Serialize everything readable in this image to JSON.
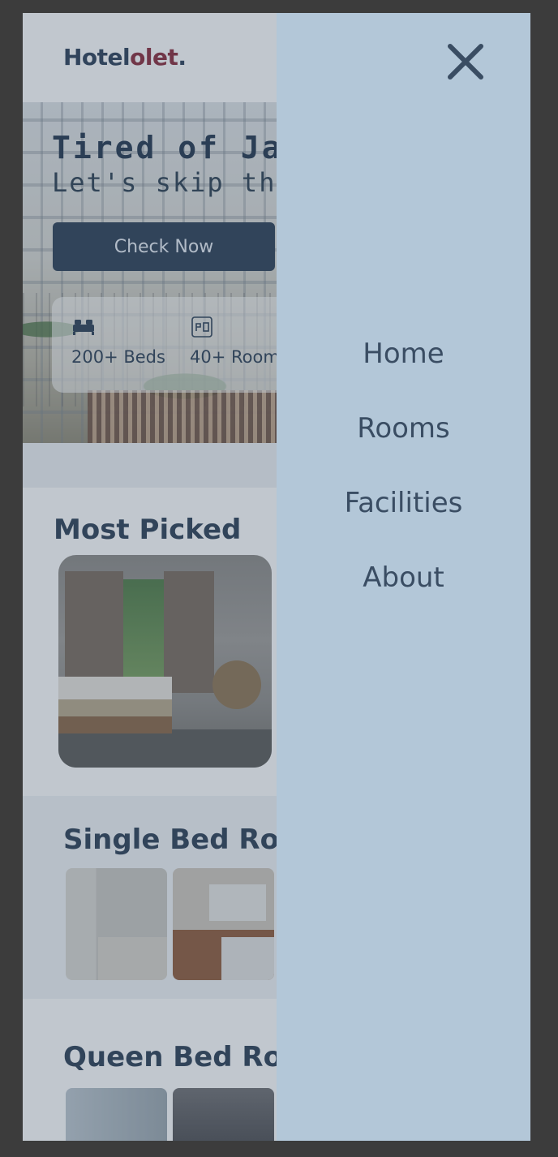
{
  "header": {
    "logo_main": "Hotel",
    "logo_accent": "olet",
    "logo_dot": "."
  },
  "hero": {
    "title": "Tired of Jak",
    "subtitle": "Let's skip the tr",
    "cta_label": "Check Now",
    "stats": [
      {
        "icon": "bed-icon",
        "label": "200+ Beds"
      },
      {
        "icon": "room-icon",
        "label": "40+ Room"
      }
    ]
  },
  "sections": {
    "most_picked": {
      "title": "Most Picked"
    },
    "single_bed": {
      "title": "Single Bed Roo"
    },
    "queen_bed": {
      "title": "Queen Bed Roo"
    }
  },
  "drawer": {
    "close_icon": "close-icon",
    "nav": [
      {
        "label": "Home"
      },
      {
        "label": "Rooms"
      },
      {
        "label": "Facilities"
      },
      {
        "label": "About"
      }
    ]
  },
  "colors": {
    "drawer_bg": "#b3c7d8",
    "primary": "#2c3e55",
    "logo_accent": "#8a2a3a"
  }
}
